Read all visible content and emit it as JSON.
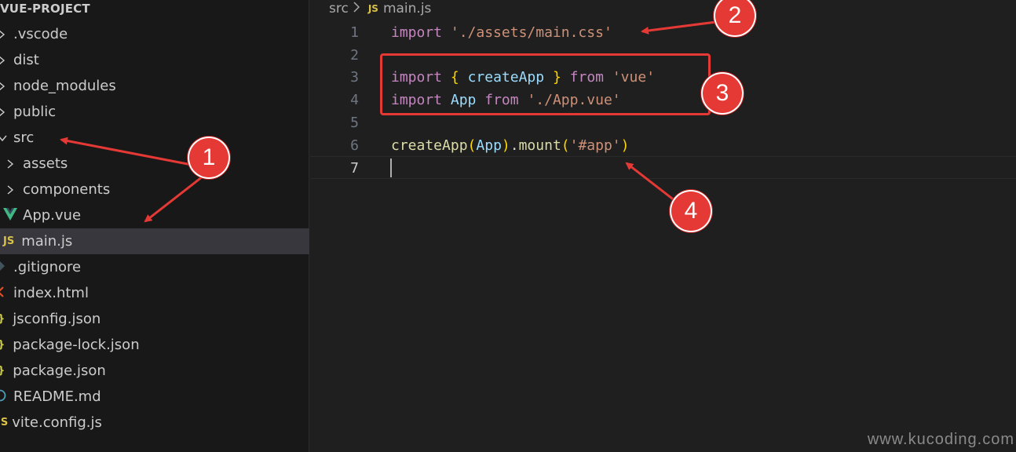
{
  "explorer": {
    "project_title": "VUE-PROJECT",
    "items": [
      {
        "label": ".vscode",
        "kind": "folder"
      },
      {
        "label": "dist",
        "kind": "folder"
      },
      {
        "label": "node_modules",
        "kind": "folder"
      },
      {
        "label": "public",
        "kind": "folder"
      },
      {
        "label": "src",
        "kind": "folder-open"
      },
      {
        "label": "assets",
        "kind": "folder"
      },
      {
        "label": "components",
        "kind": "folder"
      },
      {
        "label": "App.vue",
        "kind": "vue-file"
      },
      {
        "label": "main.js",
        "kind": "js-file",
        "selected": true
      },
      {
        "label": ".gitignore",
        "kind": "git-file"
      },
      {
        "label": "index.html",
        "kind": "html-file"
      },
      {
        "label": "jsconfig.json",
        "kind": "json-file"
      },
      {
        "label": "package-lock.json",
        "kind": "json-file"
      },
      {
        "label": "package.json",
        "kind": "json-file"
      },
      {
        "label": "README.md",
        "kind": "info-file"
      },
      {
        "label": "vite.config.js",
        "kind": "js-file"
      }
    ],
    "icons": {
      "js": "JS",
      "json": "}"
    }
  },
  "editor": {
    "breadcrumb": {
      "folder": "src",
      "separator": ">",
      "file_icon": "JS",
      "file": "main.js"
    },
    "lines": [
      {
        "n": "1",
        "tokens": [
          [
            "kw",
            "import"
          ],
          [
            "plain",
            " "
          ],
          [
            "str",
            "'./assets/main.css'"
          ]
        ]
      },
      {
        "n": "2",
        "tokens": []
      },
      {
        "n": "3",
        "tokens": [
          [
            "kw",
            "import"
          ],
          [
            "plain",
            " "
          ],
          [
            "br1",
            "{"
          ],
          [
            "plain",
            " "
          ],
          [
            "var",
            "createApp"
          ],
          [
            "plain",
            " "
          ],
          [
            "br1",
            "}"
          ],
          [
            "plain",
            " "
          ],
          [
            "kw",
            "from"
          ],
          [
            "plain",
            " "
          ],
          [
            "str",
            "'vue'"
          ]
        ]
      },
      {
        "n": "4",
        "tokens": [
          [
            "kw",
            "import"
          ],
          [
            "plain",
            " "
          ],
          [
            "var",
            "App"
          ],
          [
            "plain",
            " "
          ],
          [
            "kw",
            "from"
          ],
          [
            "plain",
            " "
          ],
          [
            "str",
            "'./App.vue'"
          ]
        ]
      },
      {
        "n": "5",
        "tokens": []
      },
      {
        "n": "6",
        "tokens": [
          [
            "fn",
            "createApp"
          ],
          [
            "br1",
            "("
          ],
          [
            "var",
            "App"
          ],
          [
            "br1",
            ")"
          ],
          [
            "plain",
            "."
          ],
          [
            "fn",
            "mount"
          ],
          [
            "br1",
            "("
          ],
          [
            "str",
            "'#app'"
          ],
          [
            "br1",
            ")"
          ]
        ]
      },
      {
        "n": "7",
        "tokens": [],
        "current": true
      }
    ]
  },
  "annotations": {
    "badge1": "1",
    "badge2": "2",
    "badge3": "3",
    "badge4": "4",
    "color": "#e53935"
  },
  "watermark": "www.kucoding.com"
}
